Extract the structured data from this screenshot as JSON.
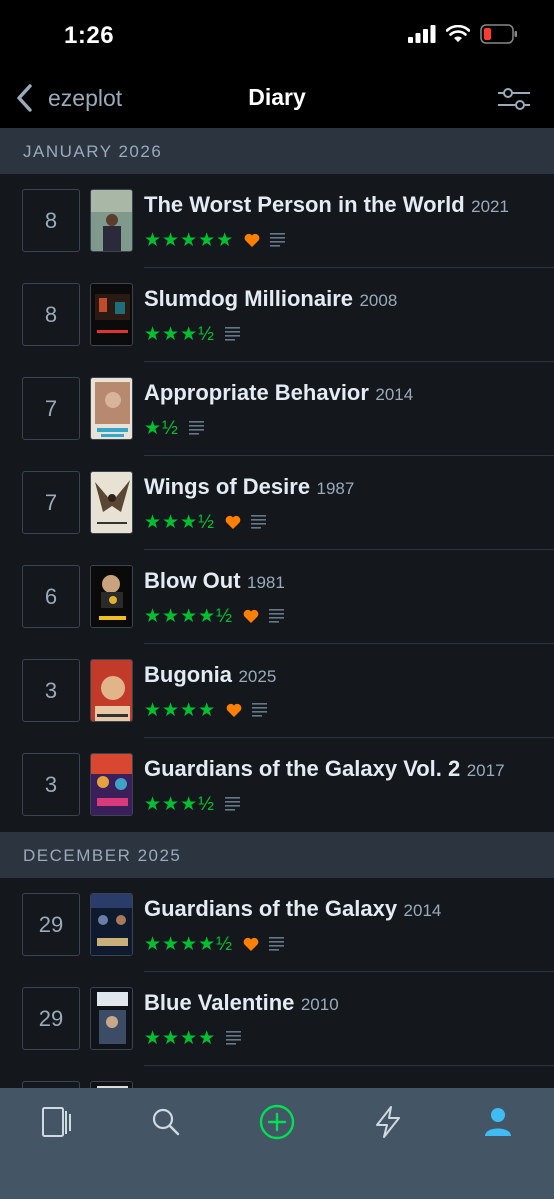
{
  "status_bar": {
    "time": "1:26"
  },
  "nav": {
    "back_label": "ezeplot",
    "title": "Diary"
  },
  "sections": [
    {
      "header": "JANUARY 2026"
    },
    {
      "header": "DECEMBER 2025"
    }
  ],
  "entries": [
    {
      "day": "8",
      "title": "The Worst Person in the World",
      "year": "2021",
      "rating": "★★★★★",
      "liked": true,
      "review": true
    },
    {
      "day": "8",
      "title": "Slumdog Millionaire",
      "year": "2008",
      "rating": "★★★½",
      "liked": false,
      "review": true
    },
    {
      "day": "7",
      "title": "Appropriate Behavior",
      "year": "2014",
      "rating": "★½",
      "liked": false,
      "review": true
    },
    {
      "day": "7",
      "title": "Wings of Desire",
      "year": "1987",
      "rating": "★★★½",
      "liked": true,
      "review": true
    },
    {
      "day": "6",
      "title": "Blow Out",
      "year": "1981",
      "rating": "★★★★½",
      "liked": true,
      "review": true
    },
    {
      "day": "3",
      "title": "Bugonia",
      "year": "2025",
      "rating": "★★★★",
      "liked": true,
      "review": true
    },
    {
      "day": "3",
      "title": "Guardians of the Galaxy Vol. 2",
      "year": "2017",
      "rating": "★★★½",
      "liked": false,
      "review": true
    },
    {
      "day": "29",
      "title": "Guardians of the Galaxy",
      "year": "2014",
      "rating": "★★★★½",
      "liked": true,
      "review": true
    },
    {
      "day": "29",
      "title": "Blue Valentine",
      "year": "2010",
      "rating": "★★★★",
      "liked": false,
      "review": true
    }
  ],
  "tabs": [
    "films-icon",
    "search-icon",
    "add-icon",
    "activity-icon",
    "profile-icon"
  ],
  "colors": {
    "star": "#00c030",
    "heart": "#ff8000",
    "accent": "#40bcf4",
    "add": "#00e054"
  }
}
